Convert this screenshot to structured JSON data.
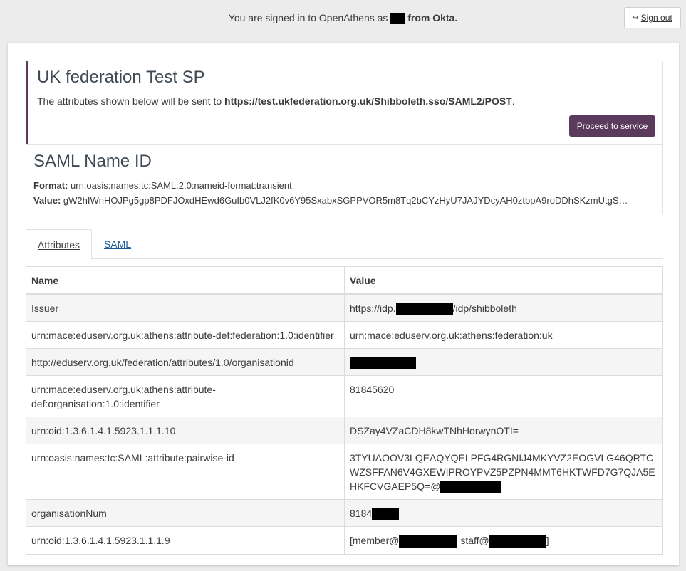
{
  "header": {
    "signed_prefix": "You are signed in to OpenAthens as",
    "signed_suffix": "from Okta.",
    "signout_label": "Sign out"
  },
  "service": {
    "title": "UK federation Test SP",
    "desc_prefix": "The attributes shown below will be sent to ",
    "endpoint": "https://test.ukfederation.org.uk/Shibboleth.sso/SAML2/POST",
    "desc_suffix": ".",
    "proceed_label": "Proceed to service"
  },
  "nameid": {
    "title": "SAML Name ID",
    "format_label": "Format:",
    "format_value": "urn:oasis:names:tc:SAML:2.0:nameid-format:transient",
    "value_label": "Value:",
    "value": "gW2hIWnHOJPg5gp8PDFJOxdHEwd6GuIb0VLJ2fK0v6Y95SxabxSGPPVOR5m8Tq2bCYzHyU7JAJYDcyAH0ztbpA9roDDhSKzmUtgS…"
  },
  "tabs": [
    {
      "label": "Attributes"
    },
    {
      "label": "SAML"
    }
  ],
  "table": {
    "headers": [
      "Name",
      "Value"
    ],
    "rows": [
      {
        "name": "Issuer",
        "value_prefix": "https://idp.",
        "value_suffix": "/idp/shibboleth"
      },
      {
        "name": "urn:mace:eduserv.org.uk:athens:attribute-def:federation:1.0:identifier",
        "value": "urn:mace:eduserv.org.uk:athens:federation:uk"
      },
      {
        "name": "http://eduserv.org.uk/federation/attributes/1.0/organisationid",
        "value": ""
      },
      {
        "name": "urn:mace:eduserv.org.uk:athens:attribute-def:organisation:1.0:identifier",
        "value": "81845620"
      },
      {
        "name": "urn:oid:1.3.6.1.4.1.5923.1.1.1.10",
        "value": "DSZay4VZaCDH8kwTNhHorwynOTI="
      },
      {
        "name": "urn:oasis:names:tc:SAML:attribute:pairwise-id",
        "value_prefix": "3TYUAOOV3LQEAQYQELPFG4RGNIJ4MKYVZ2EOGVLG46QRTCWZSFFAN6V4GXEWIPROYPVZ5PZPN4MMT6HKTWFD7G7QJA5EHKFCVGAEP5Q=@"
      },
      {
        "name": "organisationNum",
        "value_prefix": "8184"
      },
      {
        "name": "urn:oid:1.3.6.1.4.1.5923.1.1.1.9",
        "value_prefix": "[member@",
        "value_mid": " staff@",
        "value_suffix": "]"
      }
    ]
  }
}
